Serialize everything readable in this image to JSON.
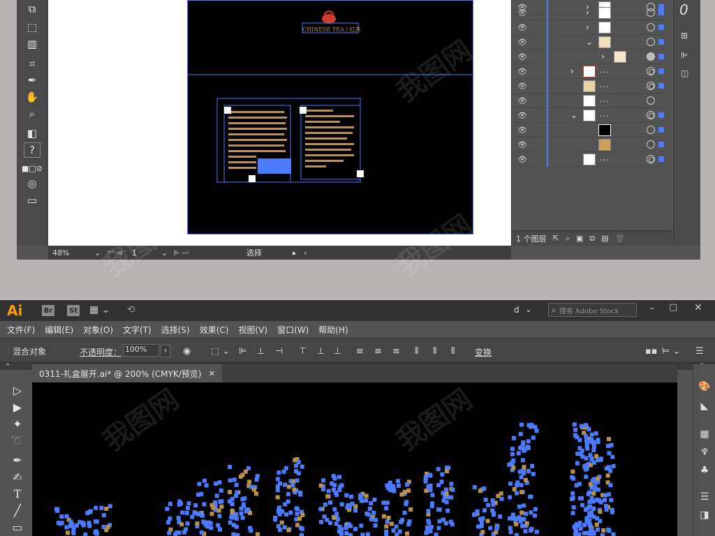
{
  "top_window": {
    "status": {
      "zoom": "48%",
      "artboard": "1",
      "tool_name": "选择"
    },
    "artwork": {
      "title_text": "CHINESE TEA | 红茶"
    },
    "layers_panel": {
      "footer_count": "1 个图层",
      "rows": [
        {
          "dots": ""
        },
        {
          "dots": ""
        },
        {
          "dots": ""
        },
        {
          "dots": ""
        },
        {
          "dots": ""
        },
        {
          "dots": "..."
        },
        {
          "dots": "..."
        },
        {
          "dots": "..."
        },
        {
          "dots": "..."
        },
        {
          "dots": ""
        },
        {
          "dots": ""
        },
        {
          "dots": "..."
        }
      ]
    }
  },
  "app": {
    "logo": "Ai",
    "bridge_btn": "Br",
    "stock_btn": "St",
    "user_initial": "d",
    "search_placeholder": "搜索 Adobe Stock"
  },
  "menu": {
    "items": [
      "文件(F)",
      "编辑(E)",
      "对象(O)",
      "文字(T)",
      "选择(S)",
      "效果(C)",
      "视图(V)",
      "窗口(W)",
      "帮助(H)"
    ]
  },
  "control_bar": {
    "selection_type": "混合对象",
    "opacity_label": "不透明度：",
    "opacity_value": "100%",
    "transform_label": "变换"
  },
  "document": {
    "tab_title": "0311-礼盒展开.ai* @ 200% (CMYK/预览)",
    "close_glyph": "✕"
  },
  "colors": {
    "accent_blue": "#4b7bff",
    "canvas_black": "#000000",
    "gold": "#b8924a",
    "ai_orange": "#ff9a00"
  }
}
